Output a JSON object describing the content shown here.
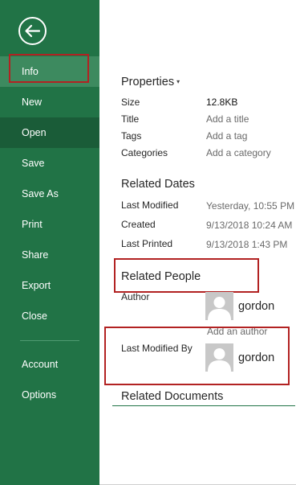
{
  "nav": {
    "back_icon": "arrow-left-circle-icon",
    "items": [
      {
        "label": "Info"
      },
      {
        "label": "New"
      },
      {
        "label": "Open"
      },
      {
        "label": "Save"
      },
      {
        "label": "Save As"
      },
      {
        "label": "Print"
      },
      {
        "label": "Share"
      },
      {
        "label": "Export"
      },
      {
        "label": "Close"
      },
      {
        "label": "Account"
      },
      {
        "label": "Options"
      }
    ]
  },
  "properties": {
    "title": "Properties",
    "rows": [
      {
        "label": "Size",
        "value": "12.8KB"
      },
      {
        "label": "Title",
        "value": "Add a title"
      },
      {
        "label": "Tags",
        "value": "Add a tag"
      },
      {
        "label": "Categories",
        "value": "Add a category"
      }
    ]
  },
  "related_dates": {
    "title": "Related Dates",
    "rows": [
      {
        "label": "Last Modified",
        "value": "Yesterday, 10:55 PM"
      },
      {
        "label": "Created",
        "value": "9/13/2018 10:24 AM"
      },
      {
        "label": "Last Printed",
        "value": "9/13/2018 1:43 PM"
      }
    ]
  },
  "related_people": {
    "title": "Related People",
    "author_label": "Author",
    "author_name": "gordon",
    "add_author": "Add an author",
    "last_modified_by_label": "Last Modified By",
    "last_modified_by_name": "gordon"
  },
  "related_documents": {
    "title": "Related Documents"
  },
  "colors": {
    "nav_bg": "#217346",
    "nav_selected": "#3d8a5f",
    "nav_active": "#1a5c38",
    "highlight": "#b22222"
  }
}
